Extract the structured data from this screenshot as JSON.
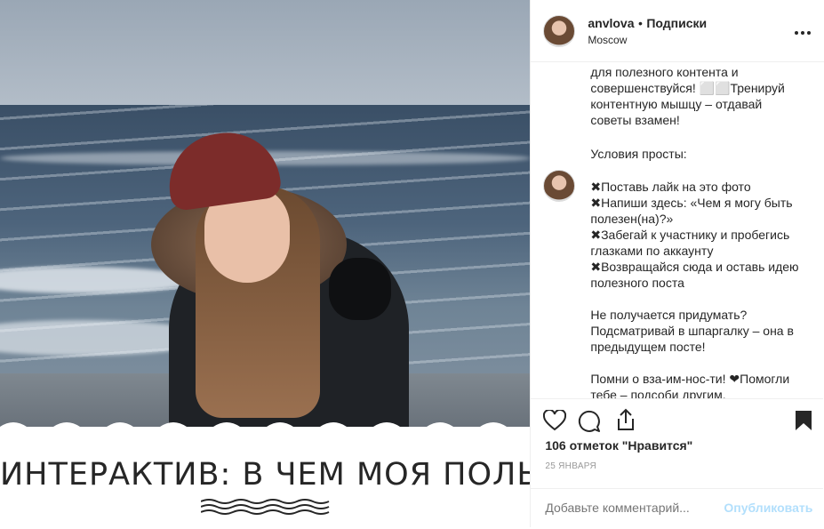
{
  "post": {
    "banner_title": "ИНТЕРАКТИВ: В ЧЕМ МОЯ ПОЛЬЗА"
  },
  "header": {
    "username": "anvlova",
    "separator": "•",
    "follow_label": "Подписки",
    "location": "Moscow",
    "more_icon": "more-horizontal-icon"
  },
  "caption": {
    "lines_top": [
      "для полезного контента и",
      "совершенствуйся! ⬜⬜Тренируй",
      "контентную мышцу – отдавай",
      "советы взамен!"
    ],
    "conditions_title": "Условия просты:",
    "lines_bottom": [
      "✖Поставь лайк на это фото",
      "✖Напиши здесь: «Чем я могу быть",
      "полезен(на)?»",
      "✖Забегай к участнику и пробегись",
      "глазками по аккаунту",
      "✖Возвращайся сюда и оставь идею",
      "полезного поста",
      "",
      "Не получается придумать?",
      "Подсматривай в шпаргалку – она в",
      "предыдущем посте!",
      "",
      "Помни о вза-им-нос-ти! ❤Помогли",
      "тебе – подсоби другим."
    ]
  },
  "actions": {
    "likes_text": "106 отметок \"Нравится\"",
    "date": "25 ЯНВАРЯ",
    "icons": [
      "heart-icon",
      "comment-icon",
      "share-icon",
      "bookmark-icon"
    ]
  },
  "comment_box": {
    "placeholder": "Добавьте комментарий...",
    "publish_label": "Опубликовать"
  },
  "colors": {
    "text": "#262626",
    "muted": "#999999",
    "publish_disabled": "#b2dffc",
    "border": "#efefef"
  }
}
